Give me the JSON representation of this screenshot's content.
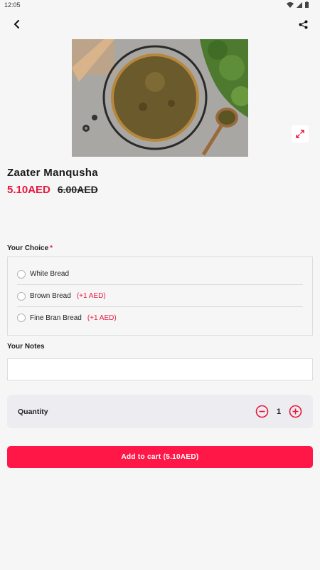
{
  "status_bar": {
    "time": "12:05"
  },
  "product": {
    "name": "Zaater Manqusha",
    "price": "5.10AED",
    "old_price": "6.00AED"
  },
  "choice_section": {
    "label": "Your Choice",
    "required_marker": "*",
    "options": [
      {
        "label": "White Bread",
        "extra": ""
      },
      {
        "label": "Brown Bread",
        "extra": "(+1 AED)"
      },
      {
        "label": "Fine Bran Bread",
        "extra": "(+1 AED)"
      }
    ]
  },
  "notes_section": {
    "label": "Your Notes",
    "value": ""
  },
  "quantity": {
    "label": "Quantity",
    "value": "1"
  },
  "cart": {
    "button_label": "Add to cart (5.10AED)"
  },
  "colors": {
    "accent": "#e8173d",
    "button": "#ff1847",
    "background": "#f6f6f7"
  },
  "icons": [
    "back-arrow-icon",
    "share-icon",
    "expand-icon",
    "minus-circle-icon",
    "plus-circle-icon",
    "wifi-icon",
    "signal-icon",
    "battery-icon"
  ]
}
